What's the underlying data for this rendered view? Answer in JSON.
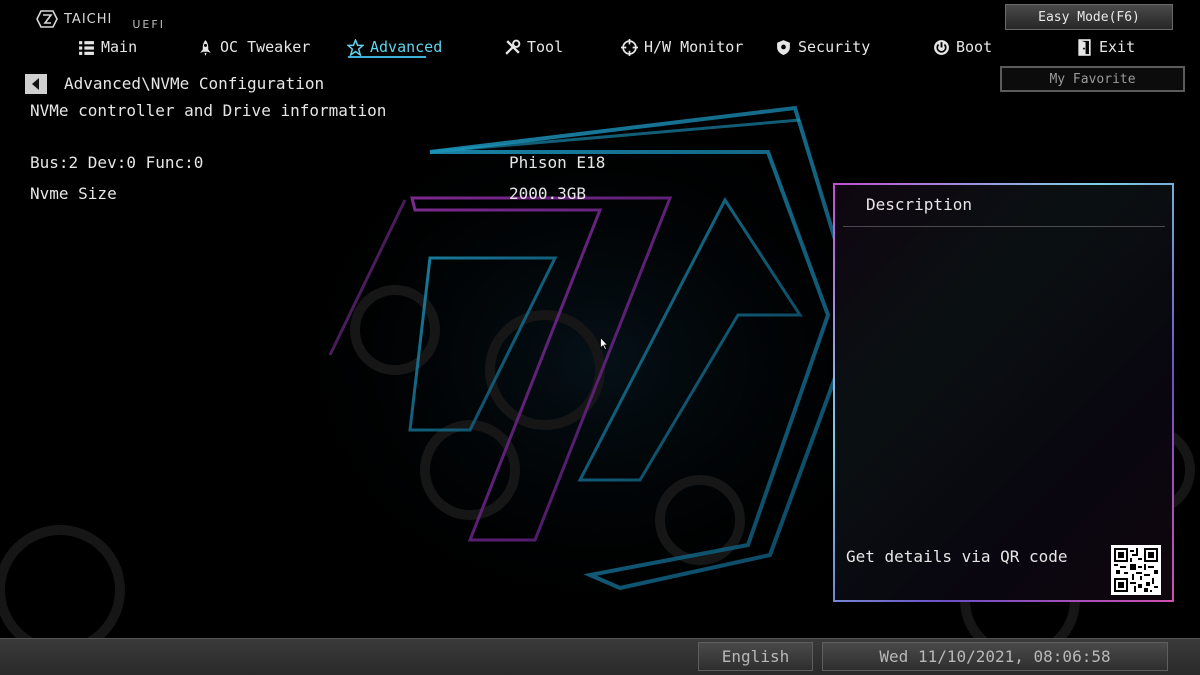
{
  "header": {
    "brand": "TAICHI",
    "uefi_label": "UEFI",
    "easy_mode_label": "Easy Mode(F6)",
    "my_favorite_label": "My Favorite"
  },
  "nav": {
    "active": "Advanced",
    "items": [
      {
        "label": "Main",
        "icon": "list-icon"
      },
      {
        "label": "OC Tweaker",
        "icon": "rocket-icon"
      },
      {
        "label": "Advanced",
        "icon": "star-icon"
      },
      {
        "label": "Tool",
        "icon": "tools-icon"
      },
      {
        "label": "H/W Monitor",
        "icon": "crosshair-icon"
      },
      {
        "label": "Security",
        "icon": "shield-icon"
      },
      {
        "label": "Boot",
        "icon": "power-icon"
      },
      {
        "label": "Exit",
        "icon": "exit-door-icon"
      }
    ]
  },
  "breadcrumb": "Advanced\\NVMe Configuration",
  "section_title": "NVMe controller and Drive information",
  "rows": [
    {
      "label": "Bus:2 Dev:0 Func:0",
      "value": "Phison E18"
    },
    {
      "label": "Nvme Size",
      "value": "2000.3GB"
    }
  ],
  "description": {
    "title": "Description",
    "qr_text": "Get details via QR code"
  },
  "status_bar": {
    "language": "English",
    "datetime": "Wed 11/10/2021, 08:06:58"
  },
  "colors": {
    "accent": "#5ed4ee",
    "panel_border_pink": "#c04fd0",
    "panel_border_cyan": "#7fd0e6",
    "background": "#000000"
  }
}
